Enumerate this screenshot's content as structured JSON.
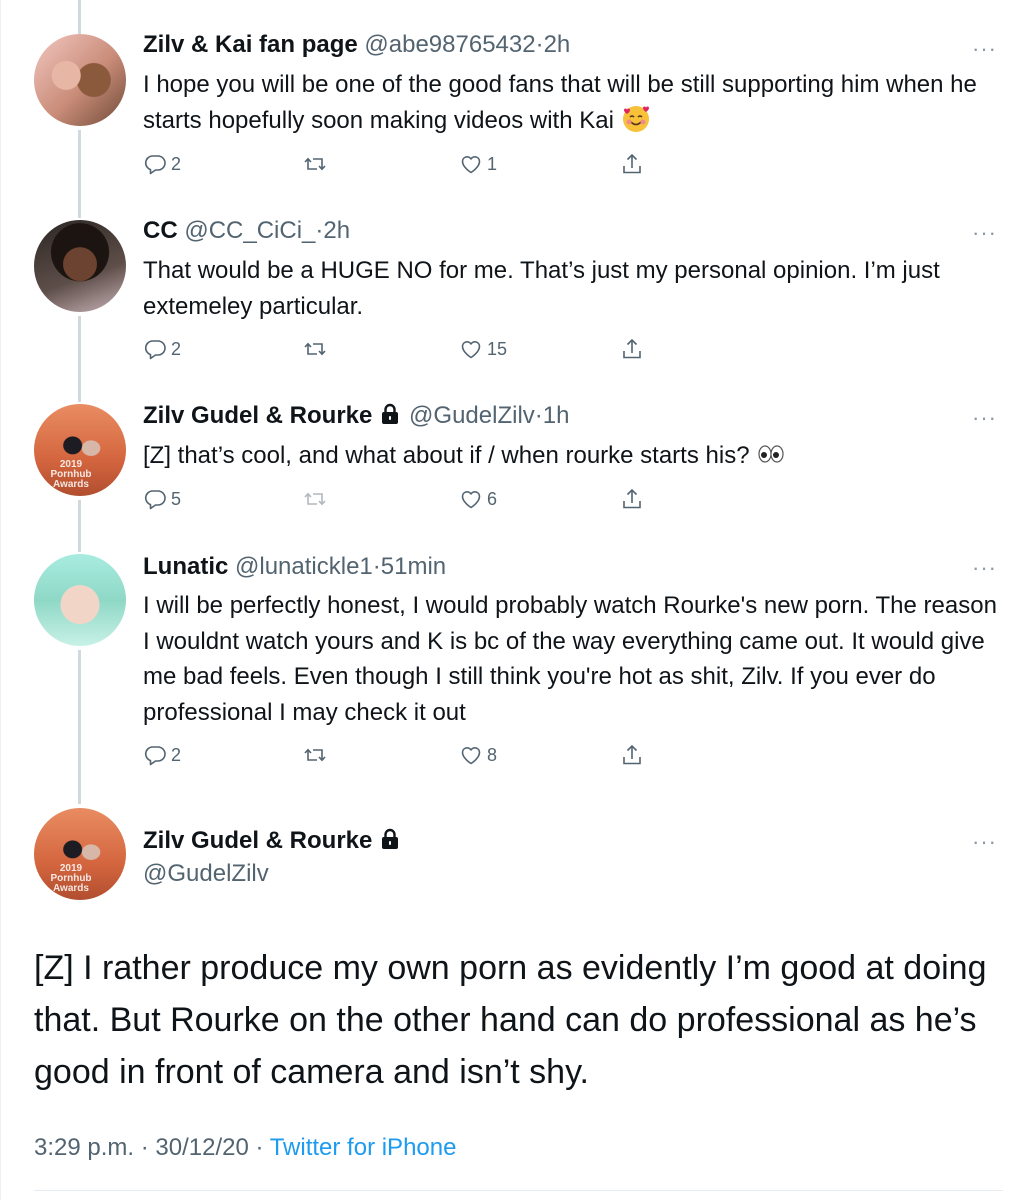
{
  "tweets": [
    {
      "name": "Zilv & Kai fan page",
      "handle": "@abe98765432",
      "time": "2h",
      "text": "I hope you will be one of the good fans that will be still supporting him when he starts hopefully soon making videos with Kai",
      "emoji": "smiling-face-with-hearts",
      "replies": "2",
      "retweets": "",
      "likes": "1"
    },
    {
      "name": "CC",
      "handle": "@CC_CiCi_",
      "time": "2h",
      "text": "That would be a HUGE NO for me. That’s just my personal opinion. I’m just extemeley particular.",
      "replies": "2",
      "retweets": "",
      "likes": "15"
    },
    {
      "name": "Zilv Gudel & Rourke",
      "handle": "@GudelZilv",
      "time": "1h",
      "locked": true,
      "text": "[Z] that’s cool, and what about if / when rourke starts his?",
      "emoji": "eyes",
      "replies": "5",
      "retweets": "",
      "likes": "6"
    },
    {
      "name": "Lunatic",
      "handle": "@lunatickle1",
      "time": "51min",
      "text": "I will be perfectly honest, I would probably watch Rourke's new porn. The reason I wouldnt watch yours and K is bc of the way everything came out. It would give me bad feels. Even though I still think you're hot as shit, Zilv. If you ever do professional I may check it out",
      "replies": "2",
      "retweets": "",
      "likes": "8"
    }
  ],
  "avatar_stamp": "2019 Pornhub Awards",
  "main_tweet": {
    "name": "Zilv Gudel & Rourke",
    "handle": "@GudelZilv",
    "locked": true,
    "text": "[Z] I rather produce my own porn as evidently I’m good at doing that. But Rourke on the other hand can do professional as he’s good in front of camera and isn’t shy.",
    "timestamp": "3:29 p.m. · 30/12/20 ·",
    "source": "Twitter for iPhone"
  },
  "separator": "·",
  "more_glyph": "···",
  "icons": {
    "reply": "reply-icon",
    "retweet": "retweet-icon",
    "like": "heart-icon",
    "share": "share-icon",
    "more": "more-icon",
    "lock": "lock-icon"
  },
  "colors": {
    "text": "#0f1419",
    "secondary": "#536471",
    "link": "#1d9bf0",
    "thread_line": "#cfd9de"
  }
}
